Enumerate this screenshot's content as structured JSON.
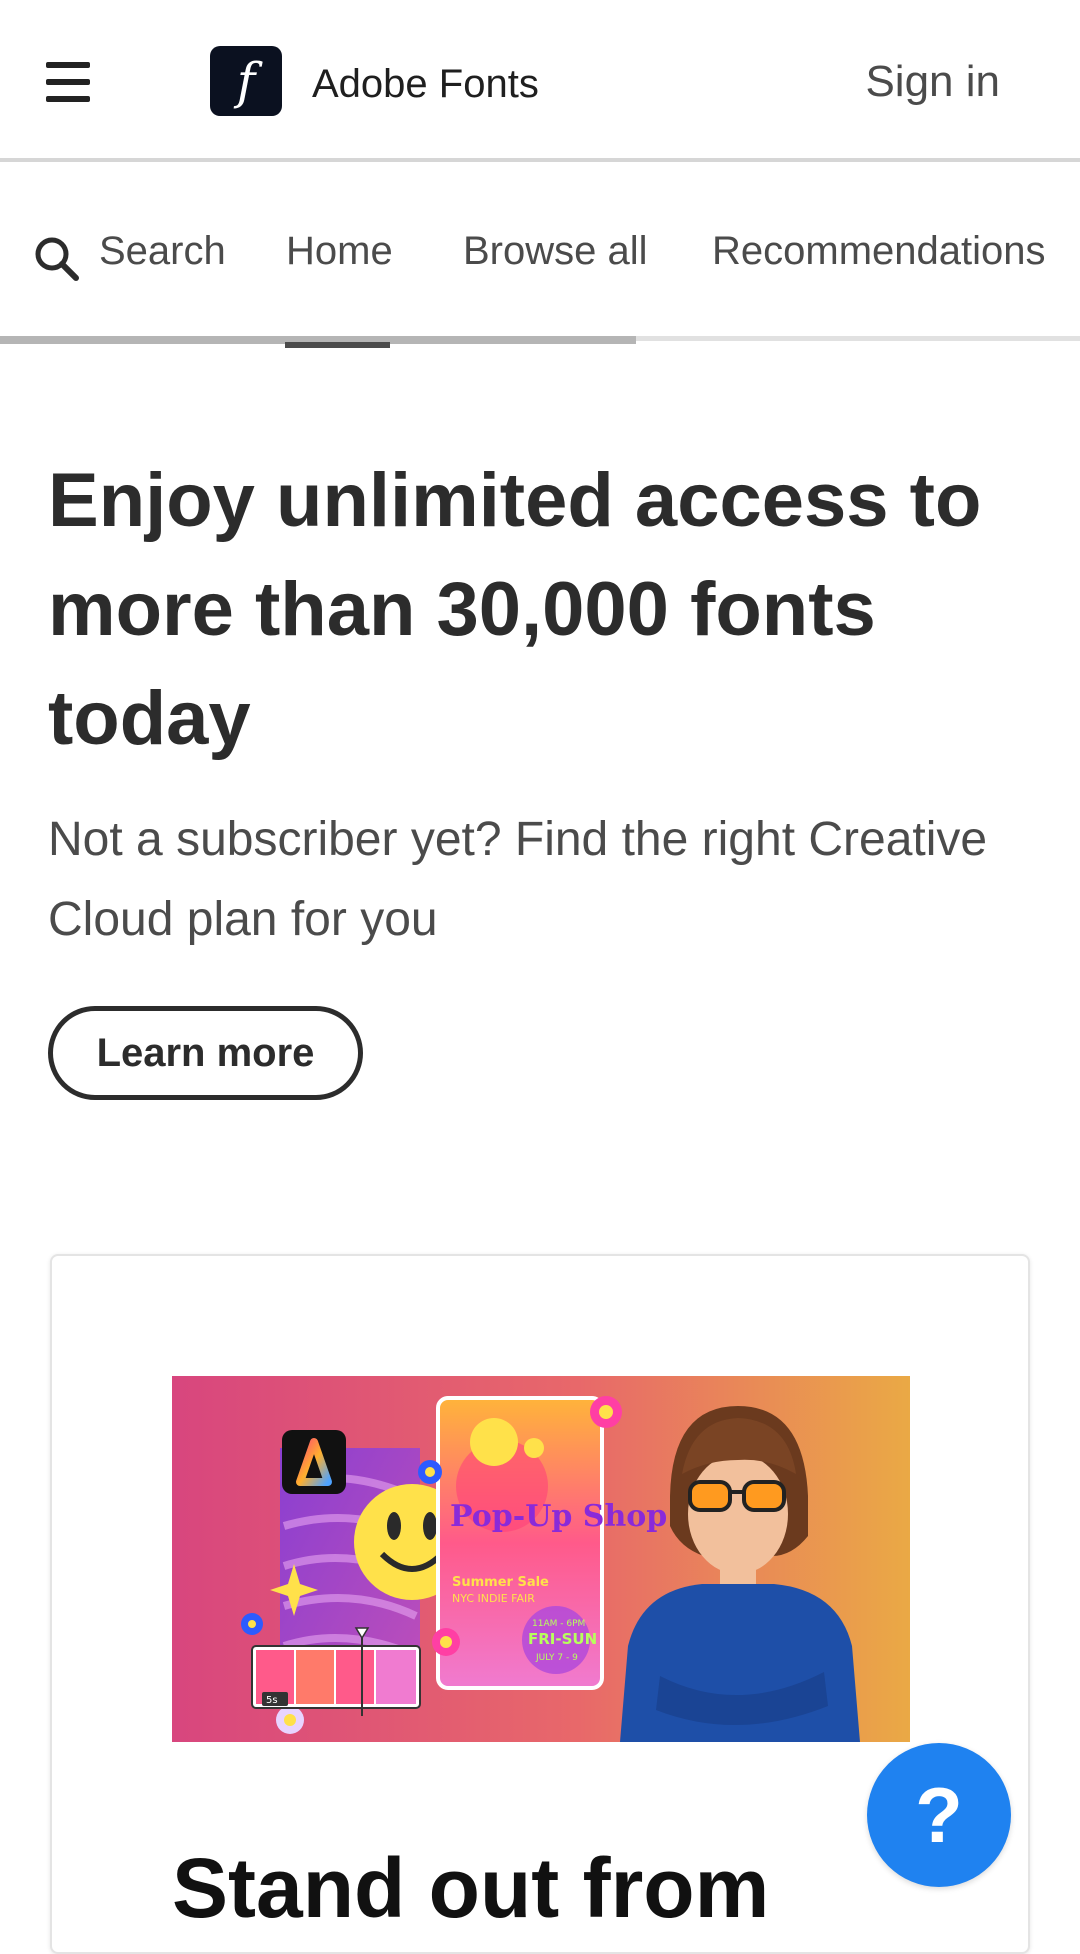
{
  "header": {
    "logo_glyph": "f",
    "brand": "Adobe Fonts",
    "sign_in": "Sign in"
  },
  "nav": {
    "items": [
      {
        "label": "Search",
        "icon": "search-icon"
      },
      {
        "label": "Home",
        "active": true
      },
      {
        "label": "Browse all"
      },
      {
        "label": "Recommendations"
      }
    ]
  },
  "hero": {
    "title": "Enjoy unlimited access to more than 30,000 fonts today",
    "subtitle": "Not a subscriber yet? Find the right Creative Cloud plan for you",
    "cta": "Learn more"
  },
  "promo": {
    "image": {
      "app_icon": "adobe-express-icon",
      "poster_title": "Pop-Up Shop",
      "poster_line1": "Summer Sale",
      "poster_line2": "NYC INDIE FAIR",
      "poster_time": "11AM - 6PM",
      "poster_days": "FRI-SUN",
      "poster_date": "JULY 7 - 9",
      "clip_duration": "5s"
    },
    "title": "Stand out from"
  },
  "help": {
    "label": "?"
  },
  "colors": {
    "header_border": "#d6d6d6",
    "text_dark": "#2c2c2c",
    "text_muted": "#4b4b4b",
    "logo_bg": "#0b1120",
    "help_blue": "#1f82f0",
    "banner_gradient_start": "#d8467e",
    "banner_gradient_end": "#eaa945",
    "sweater_blue": "#1e4fa8"
  }
}
